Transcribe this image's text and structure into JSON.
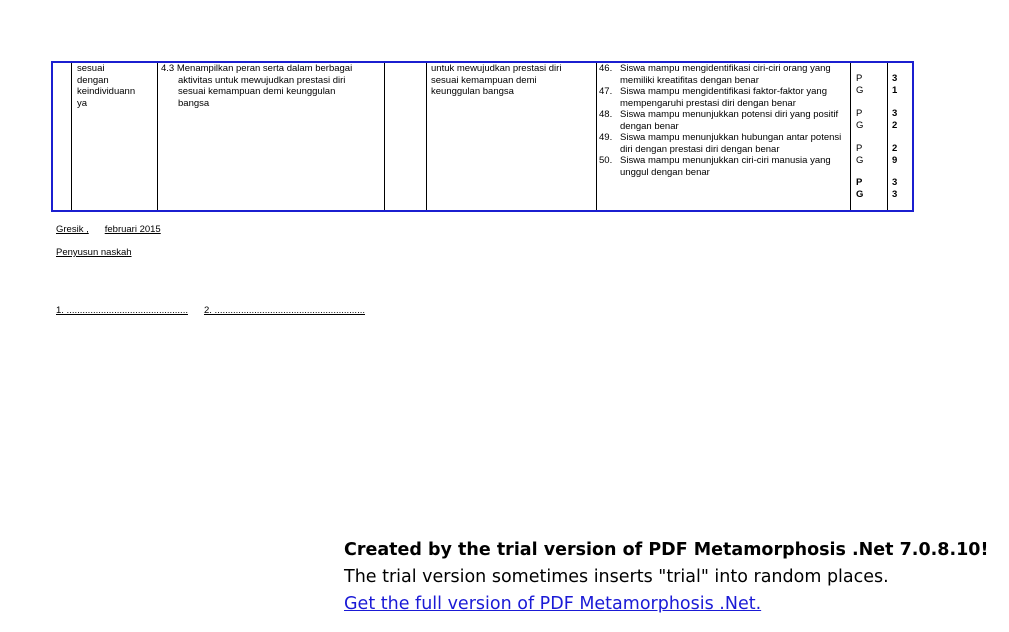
{
  "table": {
    "col1_lines": [
      "sesuai",
      "dengan",
      "keindividuann",
      "ya"
    ],
    "col2": {
      "num": "4.3",
      "lines": [
        "Menampilkan peran serta dalam berbagai",
        "aktivitas untuk mewujudkan prestasi diri",
        "sesuai kemampuan demi keunggulan",
        "bangsa"
      ]
    },
    "col4_lines": [
      "untuk mewujudkan prestasi diri",
      "sesuai kemampuan demi",
      "keunggulan bangsa"
    ],
    "indicators": [
      {
        "num": "46.",
        "text": "Siswa mampu mengidentifikasi ciri-ciri orang yang memiliki kreatifitas dengan benar"
      },
      {
        "num": "47.",
        "text": "Siswa mampu mengidentifikasi faktor-faktor yang mempengaruhi prestasi diri dengan benar"
      },
      {
        "num": "48.",
        "text": "Siswa mampu menunjukkan potensi diri yang positif dengan benar"
      },
      {
        "num": "49.",
        "text": "Siswa mampu menunjukkan hubungan antar potensi diri dengan prestasi diri dengan benar"
      },
      {
        "num": "50.",
        "text": "Siswa mampu menunjukkan ciri-ciri manusia yang unggul dengan benar"
      }
    ],
    "pg": [
      {
        "p": "P",
        "g": "G",
        "s1": "3",
        "s2": "1"
      },
      {
        "p": "P",
        "g": "G",
        "s1": "3",
        "s2": "2"
      },
      {
        "p": "P",
        "g": "G",
        "s1": "2",
        "s2": "9"
      },
      {
        "p": "P",
        "g": "G",
        "s1": "3",
        "s2": "3"
      }
    ]
  },
  "footer": {
    "place_date": "Gresik ,",
    "month_year": "februari 2015",
    "role": "Penyusun naskah",
    "sig1": "1. ..............................................",
    "sig2": "2. ........................................................."
  },
  "watermark": {
    "line1": "Created by the trial version of PDF Metamorphosis .Net 7.0.8.10!",
    "line2": "The trial version sometimes inserts \"trial\" into random places.",
    "link": "Get the full version of PDF Metamorphosis .Net."
  },
  "colors": {
    "table_border": "#1b1fd0",
    "link": "#1a1ad6"
  }
}
